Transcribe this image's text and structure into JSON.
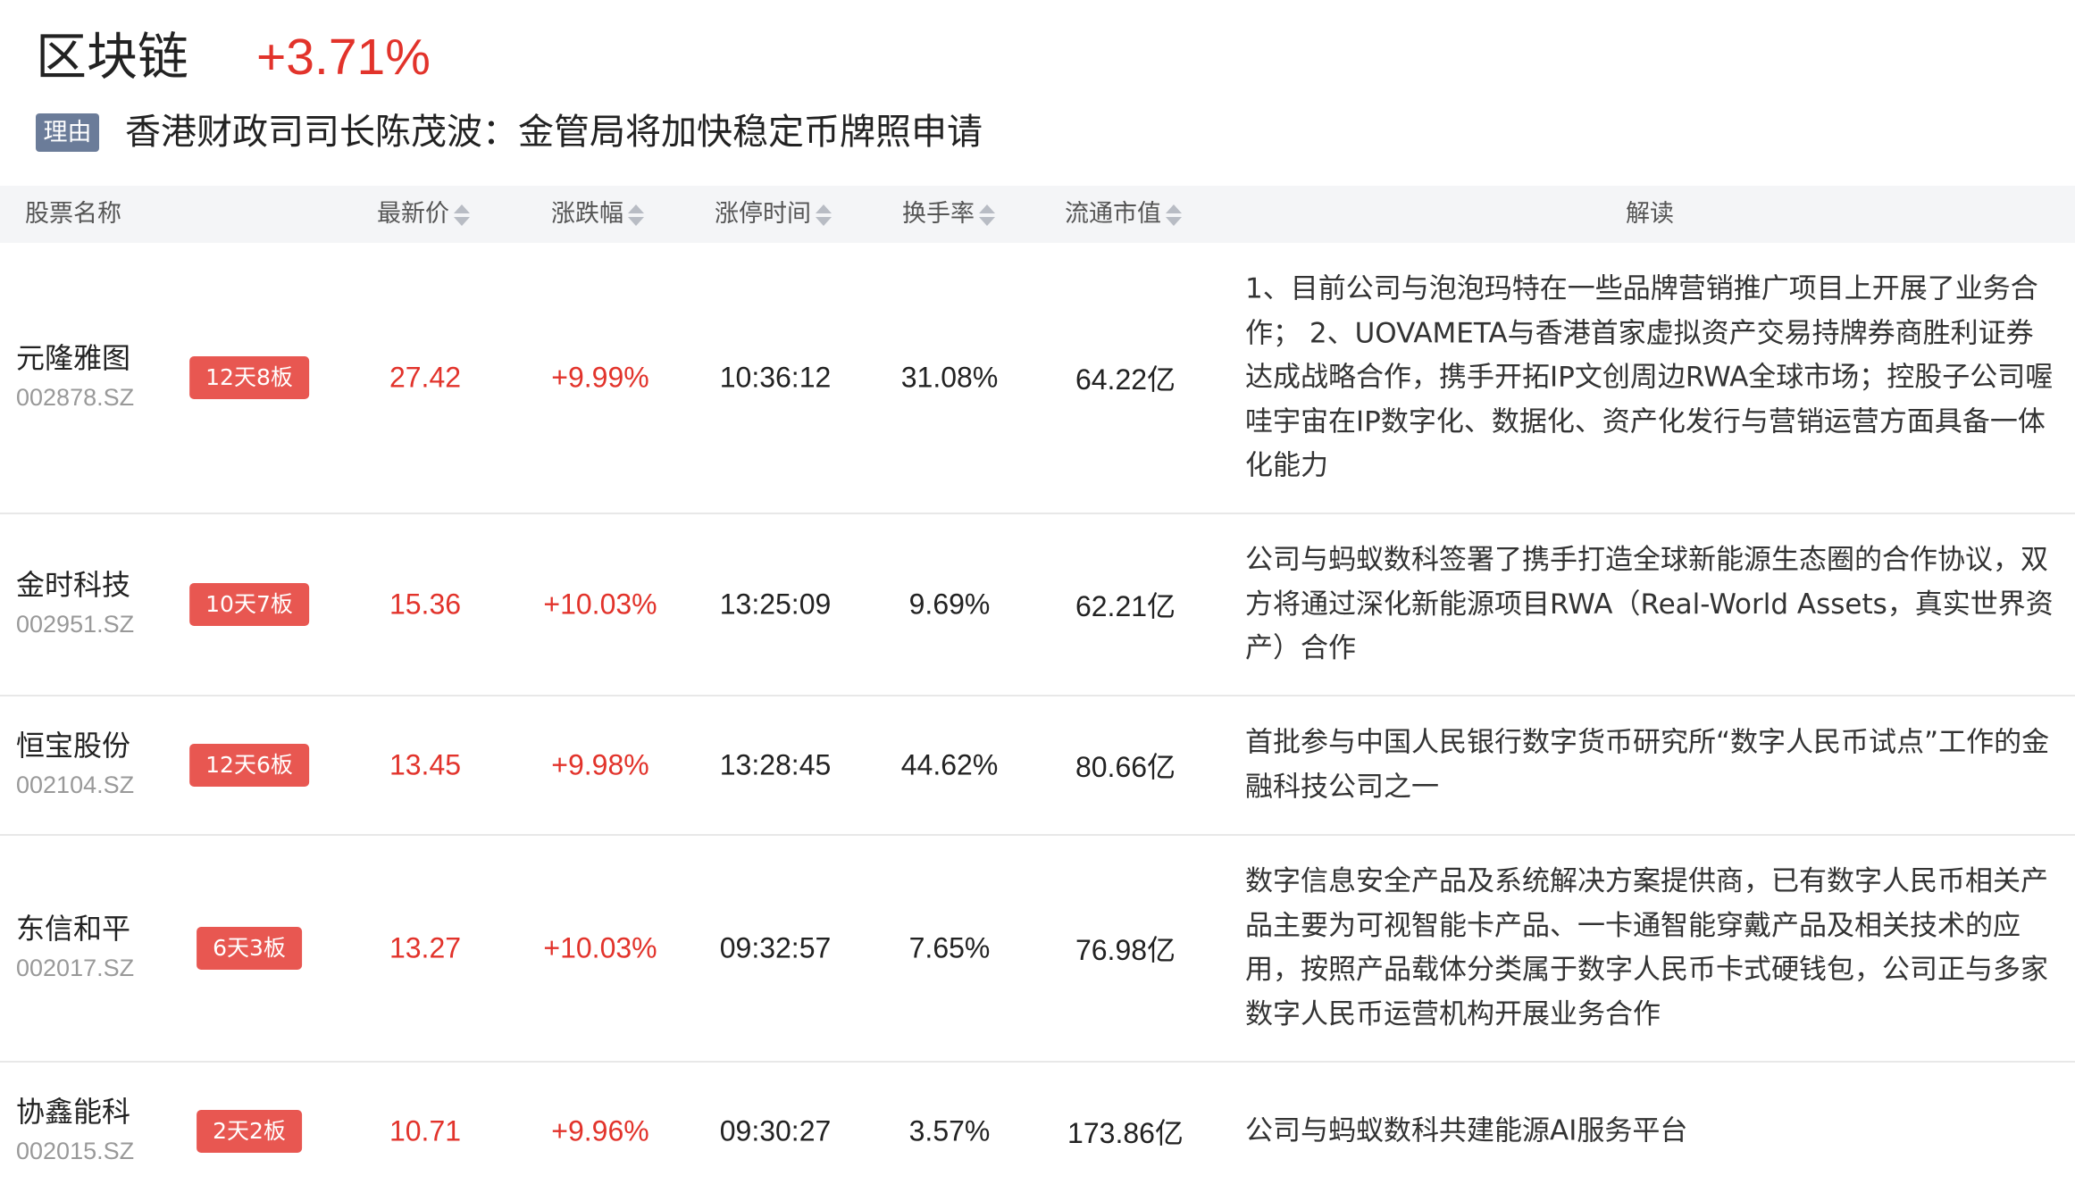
{
  "sector": {
    "name": "区块链",
    "change": "+3.71%"
  },
  "reason": {
    "tag": "理由",
    "text": "香港财政司司长陈茂波：金管局将加快稳定币牌照申请"
  },
  "columns": {
    "name": "股票名称",
    "price": "最新价",
    "change": "涨跌幅",
    "limit_time": "涨停时间",
    "turnover": "换手率",
    "market_cap": "流通市值",
    "interpretation": "解读"
  },
  "colors": {
    "up": "#e2332b",
    "board_badge": "#e85751",
    "reason_tag": "#6b7c99",
    "header_bg": "#f4f5f7"
  },
  "rows": [
    {
      "name": "元隆雅图",
      "code": "002878.SZ",
      "board": "12天8板",
      "price": "27.42",
      "change": "+9.99%",
      "limit_time": "10:36:12",
      "turnover": "31.08%",
      "market_cap": "64.22亿",
      "interpretation": "1、目前公司与泡泡玛特在一些品牌营销推广项目上开展了业务合作； 2、UOVAMETA与香港首家虚拟资产交易持牌券商胜利证券达成战略合作，携手开拓IP文创周边RWA全球市场；控股子公司喔哇宇宙在IP数字化、数据化、资产化发行与营销运营方面具备一体化能力"
    },
    {
      "name": "金时科技",
      "code": "002951.SZ",
      "board": "10天7板",
      "price": "15.36",
      "change": "+10.03%",
      "limit_time": "13:25:09",
      "turnover": "9.69%",
      "market_cap": "62.21亿",
      "interpretation": "公司与蚂蚁数科签署了携手打造全球新能源生态圈的合作协议，双方将通过深化新能源项目RWA（Real-World Assets，真实世界资产）合作"
    },
    {
      "name": "恒宝股份",
      "code": "002104.SZ",
      "board": "12天6板",
      "price": "13.45",
      "change": "+9.98%",
      "limit_time": "13:28:45",
      "turnover": "44.62%",
      "market_cap": "80.66亿",
      "interpretation": "首批参与中国人民银行数字货币研究所“数字人民币试点”工作的金融科技公司之一"
    },
    {
      "name": "东信和平",
      "code": "002017.SZ",
      "board": "6天3板",
      "price": "13.27",
      "change": "+10.03%",
      "limit_time": "09:32:57",
      "turnover": "7.65%",
      "market_cap": "76.98亿",
      "interpretation": "数字信息安全产品及系统解决方案提供商，已有数字人民币相关产品主要为可视智能卡产品、一卡通智能穿戴产品及相关技术的应用，按照产品载体分类属于数字人民币卡式硬钱包，公司正与多家数字人民币运营机构开展业务合作"
    },
    {
      "name": "协鑫能科",
      "code": "002015.SZ",
      "board": "2天2板",
      "price": "10.71",
      "change": "+9.96%",
      "limit_time": "09:30:27",
      "turnover": "3.57%",
      "market_cap": "173.86亿",
      "interpretation": "公司与蚂蚁数科共建能源AI服务平台"
    }
  ]
}
